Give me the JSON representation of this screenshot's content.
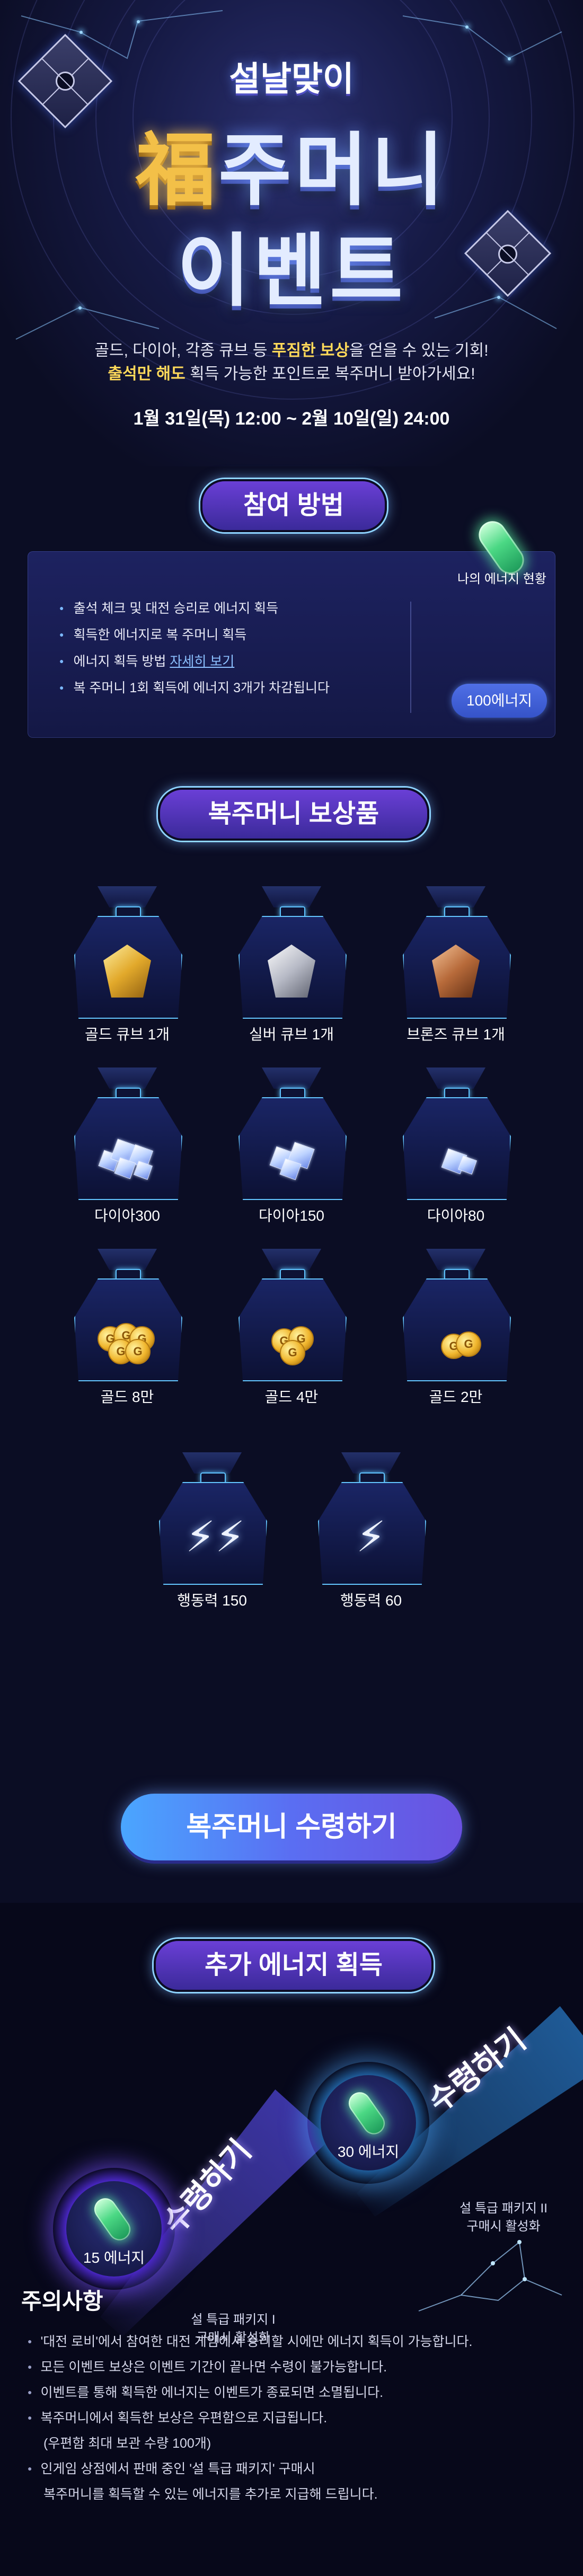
{
  "hero": {
    "subtitle": "설날맞이",
    "title_prefix": "福",
    "title_rest": "주머니",
    "title_line2": "이벤트",
    "desc1_a": "골드, 다이아, 각종 큐브 등 ",
    "desc1_hl": "푸짐한 보상",
    "desc1_b": "을 얻을 수 있는 기회!",
    "desc2_hl": "출석만 해도",
    "desc2_b": " 획득 가능한 포인트로 복주머니 받아가세요!",
    "date": "1월 31일(목) 12:00 ~ 2월 10일(일) 24:00"
  },
  "participation": {
    "heading": "참여 방법",
    "steps": [
      "출석 체크 및 대전 승리로 에너지 획득",
      "획득한 에너지로 복 주머니 획득",
      "에너지 획득 방법 ",
      "복 주머니 1회 획득에 에너지 3개가 차감됩니다"
    ],
    "detail_link": "자세히 보기",
    "energy_status_label": "나의 에너지 현황",
    "energy_value": "100에너지"
  },
  "rewards": {
    "heading": "복주머니 보상품",
    "items": [
      {
        "name": "골드 큐브 1개",
        "icon": "gold-cube-icon"
      },
      {
        "name": "실버 큐브 1개",
        "icon": "silver-cube-icon"
      },
      {
        "name": "브론즈 큐브 1개",
        "icon": "bronze-cube-icon"
      },
      {
        "name": "다이아300",
        "icon": "diamond-pile-large-icon"
      },
      {
        "name": "다이아150",
        "icon": "diamond-pile-medium-icon"
      },
      {
        "name": "다이아80",
        "icon": "diamond-pile-small-icon"
      },
      {
        "name": "골드 8만",
        "icon": "gold-coins-large-icon"
      },
      {
        "name": "골드 4만",
        "icon": "gold-coins-medium-icon"
      },
      {
        "name": "골드 2만",
        "icon": "gold-coins-small-icon"
      },
      {
        "name": "행동력 150",
        "icon": "double-lightning-icon"
      },
      {
        "name": "행동력 60",
        "icon": "lightning-icon"
      }
    ],
    "claim_button": "복주머니 수령하기"
  },
  "extra_energy": {
    "heading": "추가 에너지 획득",
    "offers": [
      {
        "button": "수령하기",
        "value": "15 에너지",
        "pkg_line1": "설 특급 패키지 I",
        "pkg_line2": "구매시 활성화"
      },
      {
        "button": "수령하기",
        "value": "30 에너지",
        "pkg_line1": "설 특급 패키지 II",
        "pkg_line2": "구매시 활성화"
      }
    ]
  },
  "notice": {
    "title": "주의사항",
    "items": [
      {
        "text": "'대전 로비'에서 참여한 대전 게임에서 승리할 시에만 에너지 획득이 가능합니다.",
        "bullet": true
      },
      {
        "text": "모든 이벤트 보상은 이벤트 기간이 끝나면 수령이 불가능합니다.",
        "bullet": true
      },
      {
        "text": "이벤트를 통해 획득한 에너지는 이벤트가 종료되면 소멸됩니다.",
        "bullet": true
      },
      {
        "text": "복주머니에서 획득한 보상은 우편함으로 지급됩니다.",
        "bullet": true
      },
      {
        "text": "(우편함 최대 보관 수량 100개)",
        "bullet": false
      },
      {
        "text": "인게임 상점에서 판매 중인 '설 특급 패키지' 구매시",
        "bullet": true
      },
      {
        "text": "복주머니를 획득할 수 있는 에너지를 추가로 지급해 드립니다.",
        "bullet": false
      }
    ]
  },
  "colors": {
    "background": "#0b0d24",
    "accent_gold": "#ffd95a",
    "pill_purple": "#6a3fd6",
    "button_blue": "#4aa6ff",
    "energy_green": "#4bd884"
  }
}
